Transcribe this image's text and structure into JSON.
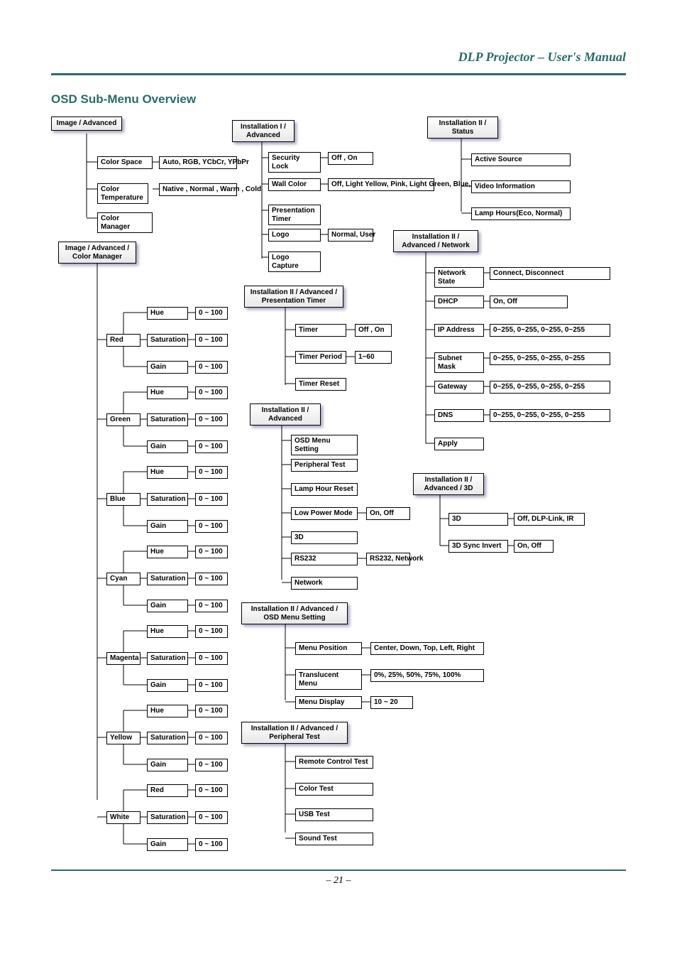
{
  "header": "DLP Projector – User's Manual",
  "section_title": "OSD Sub-Menu Overview",
  "page_number": "– 21 –",
  "roots": {
    "image_adv": "Image / Advanced",
    "image_adv_cm": "Image / Advanced / Color Manager",
    "inst1_adv": "Installation I / Advanced",
    "inst2_pt": "Installation II / Advanced / Presentation Timer",
    "inst2_adv": "Installation II / Advanced",
    "inst2_osd": "Installation II / Advanced / OSD Menu Setting",
    "inst2_peri": "Installation II / Advanced / Peripheral Test",
    "inst2_status": "Installation II / Status",
    "inst2_net": "Installation II / Advanced / Network",
    "inst2_3d": "Installation II / Advanced / 3D"
  },
  "image_adv_items": [
    {
      "k": "Color Space",
      "v": "Auto, RGB, YCbCr, YPbPr"
    },
    {
      "k": "Color Temperature",
      "v": "Native , Normal , Warm , Cold"
    },
    {
      "k": "Color Manager",
      "v": ""
    }
  ],
  "cm_colors": [
    "Red",
    "Green",
    "Blue",
    "Cyan",
    "Magenta",
    "Yellow",
    "White"
  ],
  "cm_params_std": [
    "Hue",
    "Saturation",
    "Gain"
  ],
  "cm_params_white": [
    "Red",
    "Saturation",
    "Gain"
  ],
  "cm_range": "0 ~ 100",
  "inst1_items": [
    {
      "k": "Security Lock",
      "v": "Off , On"
    },
    {
      "k": "Wall Color",
      "v": "Off, Light Yellow, Pink, Light Green, Blue, Blackboard"
    },
    {
      "k": "Presentation Timer",
      "v": ""
    },
    {
      "k": "Logo",
      "v": "Normal, User"
    },
    {
      "k": "Logo Capture",
      "v": ""
    }
  ],
  "pt_items": [
    {
      "k": "Timer",
      "v": "Off , On"
    },
    {
      "k": "Timer Period",
      "v": "1~60"
    },
    {
      "k": "Timer Reset",
      "v": ""
    }
  ],
  "inst2_adv_items": [
    {
      "k": "OSD Menu Setting",
      "v": ""
    },
    {
      "k": "Peripheral Test",
      "v": ""
    },
    {
      "k": "Lamp Hour Reset",
      "v": ""
    },
    {
      "k": "Low Power Mode",
      "v": "On, Off"
    },
    {
      "k": "3D",
      "v": ""
    },
    {
      "k": "RS232",
      "v": "RS232, Network"
    },
    {
      "k": "Network",
      "v": ""
    }
  ],
  "osd_items": [
    {
      "k": "Menu Position",
      "v": "Center, Down, Top, Left, Right"
    },
    {
      "k": "Translucent Menu",
      "v": "0%, 25%, 50%, 75%, 100%"
    },
    {
      "k": "Menu Display",
      "v": "10 ~ 20"
    }
  ],
  "peri_items": [
    "Remote Control Test",
    "Color Test",
    "USB Test",
    "Sound Test"
  ],
  "status_items": [
    "Active Source",
    "Video Information",
    "Lamp Hours(Eco, Normal)"
  ],
  "net_items": [
    {
      "k": "Network State",
      "v": "Connect, Disconnect"
    },
    {
      "k": "DHCP",
      "v": "On, Off"
    },
    {
      "k": "IP Address",
      "v": "0~255, 0~255, 0~255, 0~255"
    },
    {
      "k": "Subnet Mask",
      "v": "0~255, 0~255, 0~255, 0~255"
    },
    {
      "k": "Gateway",
      "v": "0~255, 0~255, 0~255, 0~255"
    },
    {
      "k": "DNS",
      "v": "0~255, 0~255, 0~255, 0~255"
    },
    {
      "k": "Apply",
      "v": ""
    }
  ],
  "td_items": [
    {
      "k": "3D",
      "v": "Off, DLP-Link, IR"
    },
    {
      "k": "3D Sync Invert",
      "v": "On, Off"
    }
  ],
  "chart_data": {
    "type": "tree",
    "trees": [
      {
        "root": "Image / Advanced",
        "children": [
          {
            "label": "Color Space",
            "value": "Auto, RGB, YCbCr, YPbPr"
          },
          {
            "label": "Color Temperature",
            "value": "Native , Normal , Warm , Cold"
          },
          {
            "label": "Color Manager"
          }
        ]
      },
      {
        "root": "Image / Advanced / Color Manager",
        "children": [
          {
            "label": "Red",
            "children": [
              {
                "label": "Hue",
                "value": "0 ~ 100"
              },
              {
                "label": "Saturation",
                "value": "0 ~ 100"
              },
              {
                "label": "Gain",
                "value": "0 ~ 100"
              }
            ]
          },
          {
            "label": "Green",
            "children": [
              {
                "label": "Hue",
                "value": "0 ~ 100"
              },
              {
                "label": "Saturation",
                "value": "0 ~ 100"
              },
              {
                "label": "Gain",
                "value": "0 ~ 100"
              }
            ]
          },
          {
            "label": "Blue",
            "children": [
              {
                "label": "Hue",
                "value": "0 ~ 100"
              },
              {
                "label": "Saturation",
                "value": "0 ~ 100"
              },
              {
                "label": "Gain",
                "value": "0 ~ 100"
              }
            ]
          },
          {
            "label": "Cyan",
            "children": [
              {
                "label": "Hue",
                "value": "0 ~ 100"
              },
              {
                "label": "Saturation",
                "value": "0 ~ 100"
              },
              {
                "label": "Gain",
                "value": "0 ~ 100"
              }
            ]
          },
          {
            "label": "Magenta",
            "children": [
              {
                "label": "Hue",
                "value": "0 ~ 100"
              },
              {
                "label": "Saturation",
                "value": "0 ~ 100"
              },
              {
                "label": "Gain",
                "value": "0 ~ 100"
              }
            ]
          },
          {
            "label": "Yellow",
            "children": [
              {
                "label": "Hue",
                "value": "0 ~ 100"
              },
              {
                "label": "Saturation",
                "value": "0 ~ 100"
              },
              {
                "label": "Gain",
                "value": "0 ~ 100"
              }
            ]
          },
          {
            "label": "White",
            "children": [
              {
                "label": "Red",
                "value": "0 ~ 100"
              },
              {
                "label": "Saturation",
                "value": "0 ~ 100"
              },
              {
                "label": "Gain",
                "value": "0 ~ 100"
              }
            ]
          }
        ]
      },
      {
        "root": "Installation I / Advanced",
        "children": [
          {
            "label": "Security Lock",
            "value": "Off , On"
          },
          {
            "label": "Wall Color",
            "value": "Off, Light Yellow, Pink, Light Green, Blue, Blackboard"
          },
          {
            "label": "Presentation Timer"
          },
          {
            "label": "Logo",
            "value": "Normal, User"
          },
          {
            "label": "Logo Capture"
          }
        ]
      },
      {
        "root": "Installation II / Advanced / Presentation Timer",
        "children": [
          {
            "label": "Timer",
            "value": "Off , On"
          },
          {
            "label": "Timer Period",
            "value": "1~60"
          },
          {
            "label": "Timer Reset"
          }
        ]
      },
      {
        "root": "Installation II / Advanced",
        "children": [
          {
            "label": "OSD Menu Setting"
          },
          {
            "label": "Peripheral Test"
          },
          {
            "label": "Lamp Hour Reset"
          },
          {
            "label": "Low Power Mode",
            "value": "On, Off"
          },
          {
            "label": "3D"
          },
          {
            "label": "RS232",
            "value": "RS232, Network"
          },
          {
            "label": "Network"
          }
        ]
      },
      {
        "root": "Installation II / Advanced / OSD Menu Setting",
        "children": [
          {
            "label": "Menu Position",
            "value": "Center, Down, Top, Left, Right"
          },
          {
            "label": "Translucent Menu",
            "value": "0%, 25%, 50%, 75%, 100%"
          },
          {
            "label": "Menu Display",
            "value": "10 ~ 20"
          }
        ]
      },
      {
        "root": "Installation II / Advanced / Peripheral Test",
        "children": [
          {
            "label": "Remote Control Test"
          },
          {
            "label": "Color Test"
          },
          {
            "label": "USB Test"
          },
          {
            "label": "Sound Test"
          }
        ]
      },
      {
        "root": "Installation II / Status",
        "children": [
          {
            "label": "Active Source"
          },
          {
            "label": "Video Information"
          },
          {
            "label": "Lamp Hours(Eco, Normal)"
          }
        ]
      },
      {
        "root": "Installation II / Advanced / Network",
        "children": [
          {
            "label": "Network State",
            "value": "Connect, Disconnect"
          },
          {
            "label": "DHCP",
            "value": "On, Off"
          },
          {
            "label": "IP Address",
            "value": "0~255, 0~255, 0~255, 0~255"
          },
          {
            "label": "Subnet Mask",
            "value": "0~255, 0~255, 0~255, 0~255"
          },
          {
            "label": "Gateway",
            "value": "0~255, 0~255, 0~255, 0~255"
          },
          {
            "label": "DNS",
            "value": "0~255, 0~255, 0~255, 0~255"
          },
          {
            "label": "Apply"
          }
        ]
      },
      {
        "root": "Installation II / Advanced / 3D",
        "children": [
          {
            "label": "3D",
            "value": "Off, DLP-Link, IR"
          },
          {
            "label": "3D Sync Invert",
            "value": "On, Off"
          }
        ]
      }
    ]
  }
}
